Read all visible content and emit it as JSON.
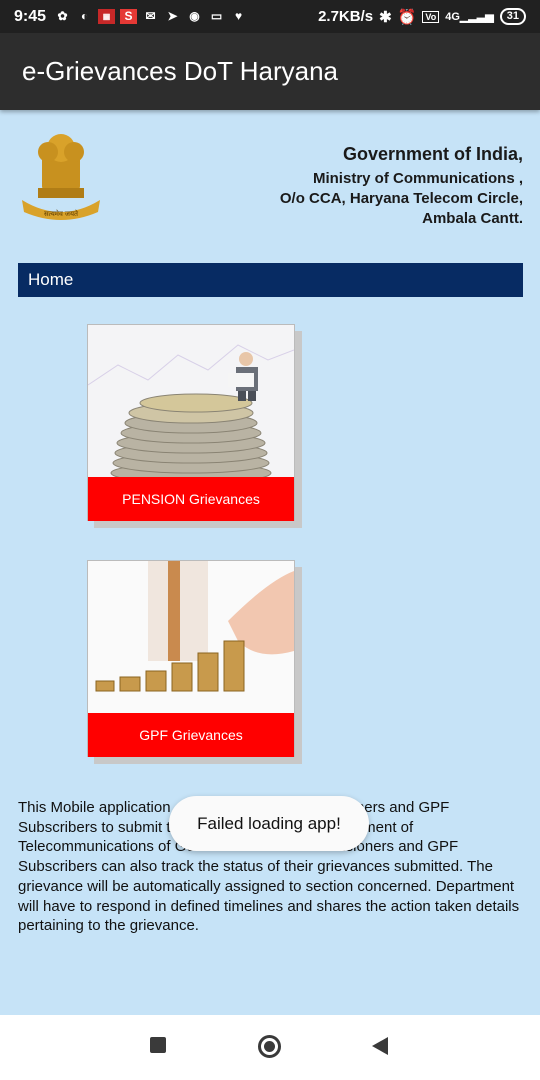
{
  "status_bar": {
    "time": "9:45",
    "network_speed": "2.7KB/s",
    "network_type": "4G",
    "battery": "31"
  },
  "app_bar": {
    "title": "e-Grievances DoT Haryana"
  },
  "header": {
    "line1": "Government of India,",
    "line2": "Ministry of Communications ,",
    "line3": "O/o CCA, Haryana Telecom Circle,",
    "line4": "Ambala Cantt.",
    "emblem_text": "सत्यमेव जयते"
  },
  "nav": {
    "home_label": "Home"
  },
  "cards": [
    {
      "label": "PENSION Grievances",
      "image": "pension-coins-man-icon"
    },
    {
      "label": "GPF Grievances",
      "image": "gpf-coin-stacks-icon"
    }
  ],
  "description": "This Mobile application enables DOT/BSNL Pensioners and GPF Subscribers to submit their grievances to the Department of Telecommunications of Government of India. Pensioners and GPF Subscribers can also track the status of their grievances submitted. The grievance will be automatically assigned to section concerned. Department will have to respond in defined timelines and shares the action taken details pertaining to the grievance.",
  "toast": {
    "message": "Failed loading app!"
  },
  "colors": {
    "background": "#c6e3f7",
    "app_bar": "#2d2d2d",
    "home_bar": "#072b63",
    "card_label": "#ff0000"
  }
}
